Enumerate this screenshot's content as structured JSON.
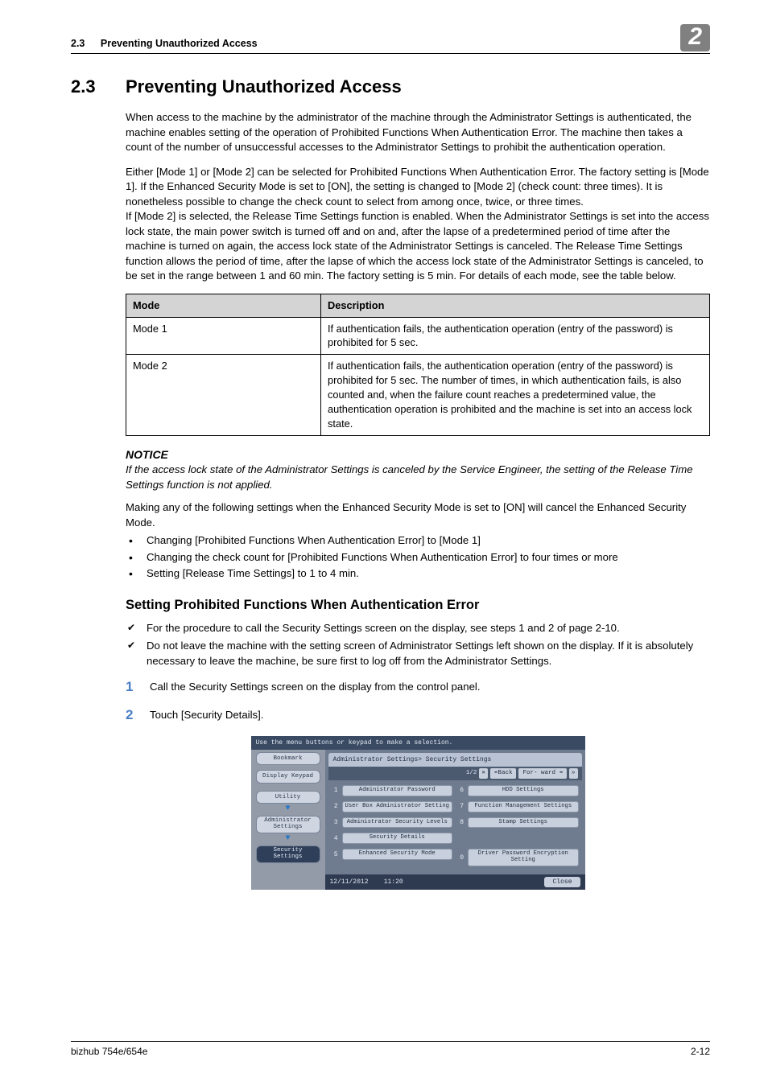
{
  "runhead": {
    "section_num": "2.3",
    "section_title": "Preventing Unauthorized Access",
    "chapter_num": "2"
  },
  "h1": {
    "num": "2.3",
    "title": "Preventing Unauthorized Access"
  },
  "intro": {
    "p1": "When access to the machine by the administrator of the machine through the Administrator Settings is authenticated, the machine enables setting of the operation of Prohibited Functions When Authentication Error. The machine then takes a count of the number of unsuccessful accesses to the Administrator Settings to prohibit the authentication operation.",
    "p2": "Either [Mode 1] or [Mode 2] can be selected for Prohibited Functions When Authentication Error. The factory setting is [Mode 1]. If the Enhanced Security Mode is set to [ON], the setting is changed to [Mode 2] (check count: three times). It is nonetheless possible to change the check count to select from among once, twice, or three times.",
    "p3": "If [Mode 2] is selected, the Release Time Settings function is enabled. When the Administrator Settings is set into the access lock state, the main power switch is turned off and on and, after the lapse of a predetermined period of time after the machine is turned on again, the access lock state of the Administrator Settings is canceled. The Release Time Settings function allows the period of time, after the lapse of which the access lock state of the Administrator Settings is canceled, to be set in the range between 1 and 60 min. The factory setting is 5 min. For details of each mode, see the table below."
  },
  "table": {
    "h_mode": "Mode",
    "h_desc": "Description",
    "r1_mode": "Mode 1",
    "r1_desc": "If authentication fails, the authentication operation (entry of the password) is prohibited for 5 sec.",
    "r2_mode": "Mode 2",
    "r2_desc": "If authentication fails, the authentication operation (entry of the password) is prohibited for 5 sec. The number of times, in which authentication fails, is also counted and, when the failure count reaches a predetermined value, the authentication operation is prohibited and the machine is set into an access lock state."
  },
  "notice": {
    "heading": "NOTICE",
    "body": "If the access lock state of the Administrator Settings is canceled by the Service Engineer, the setting of the Release Time Settings function is not applied.",
    "after": "Making any of the following settings when the Enhanced Security Mode is set to [ON] will cancel the Enhanced Security Mode.",
    "b1": "Changing [Prohibited Functions When Authentication Error] to [Mode 1]",
    "b2": "Changing the check count for [Prohibited Functions When Authentication Error] to four times or more",
    "b3": "Setting [Release Time Settings] to 1 to 4 min."
  },
  "h2": "Setting Prohibited Functions When Authentication Error",
  "checks": {
    "c1": "For the procedure to call the Security Settings screen on the display, see steps 1 and 2 of page 2-10.",
    "c2": "Do not leave the machine with the setting screen of Administrator Settings left shown on the display. If it is absolutely necessary to leave the machine, be sure first to log off from the Administrator Settings."
  },
  "steps": {
    "s1_num": "1",
    "s1": "Call the Security Settings screen on the display from the control panel.",
    "s2_num": "2",
    "s2": "Touch [Security Details]."
  },
  "screenshot": {
    "topbar": "Use the menu buttons or keypad to make a selection.",
    "sidebar": {
      "bookmark": "Bookmark",
      "display_keypad": "Display Keypad",
      "utility": "Utility",
      "admin": "Administrator Settings",
      "security": "Security Settings"
    },
    "breadcrumb": "Administrator Settings> Security Settings",
    "pager": {
      "page": "1/2",
      "back": "↞Back",
      "forward": "For- ward ↠"
    },
    "items": {
      "i1": "Administrator Password",
      "i2": "User Box Administrator Setting",
      "i3": "Administrator Security Levels",
      "i4": "Security Details",
      "i5": "Enhanced Security Mode",
      "i6": "HDD Settings",
      "i7": "Function Management Settings",
      "i8": "Stamp Settings",
      "i0": "Driver Password Encryption Setting"
    },
    "nums": {
      "n1": "1",
      "n2": "2",
      "n3": "3",
      "n4": "4",
      "n5": "5",
      "n6": "6",
      "n7": "7",
      "n8": "8",
      "n0": "0"
    },
    "footer": {
      "date": "12/11/2012",
      "time": "11:20",
      "close": "Close"
    }
  },
  "footer": {
    "left": "bizhub 754e/654e",
    "right": "2-12"
  }
}
